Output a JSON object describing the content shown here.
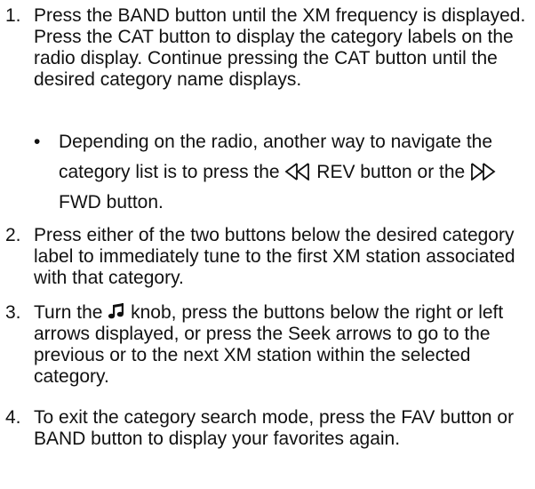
{
  "steps": [
    {
      "num": "1.",
      "text": "Press the BAND button until the XM frequency is displayed. Press the CAT button to display the category labels on the radio display. Continue pressing the CAT button until the desired category name displays."
    },
    {
      "num": "2.",
      "text": "Press either of the two buttons below the desired category label to immediately tune to the first XM station associated with that category."
    },
    {
      "num": "3.",
      "text_before": "Turn the",
      "text_after": "knob, press the buttons below the right or left arrows displayed, or press the Seek arrows to go to the previous or to the next XM station within the selected category."
    },
    {
      "num": "4.",
      "text": "To exit the category search mode, press the FAV button or BAND button to display your favorites again."
    }
  ],
  "bullet": {
    "dot": "•",
    "part1": "Depending on the radio, another way to navigate the category list is to press the",
    "part2": "REV button or the",
    "part3": "FWD button."
  },
  "icons": {
    "rev": "rev-double-arrow-icon",
    "fwd": "fwd-double-arrow-icon",
    "music": "music-note-icon"
  }
}
